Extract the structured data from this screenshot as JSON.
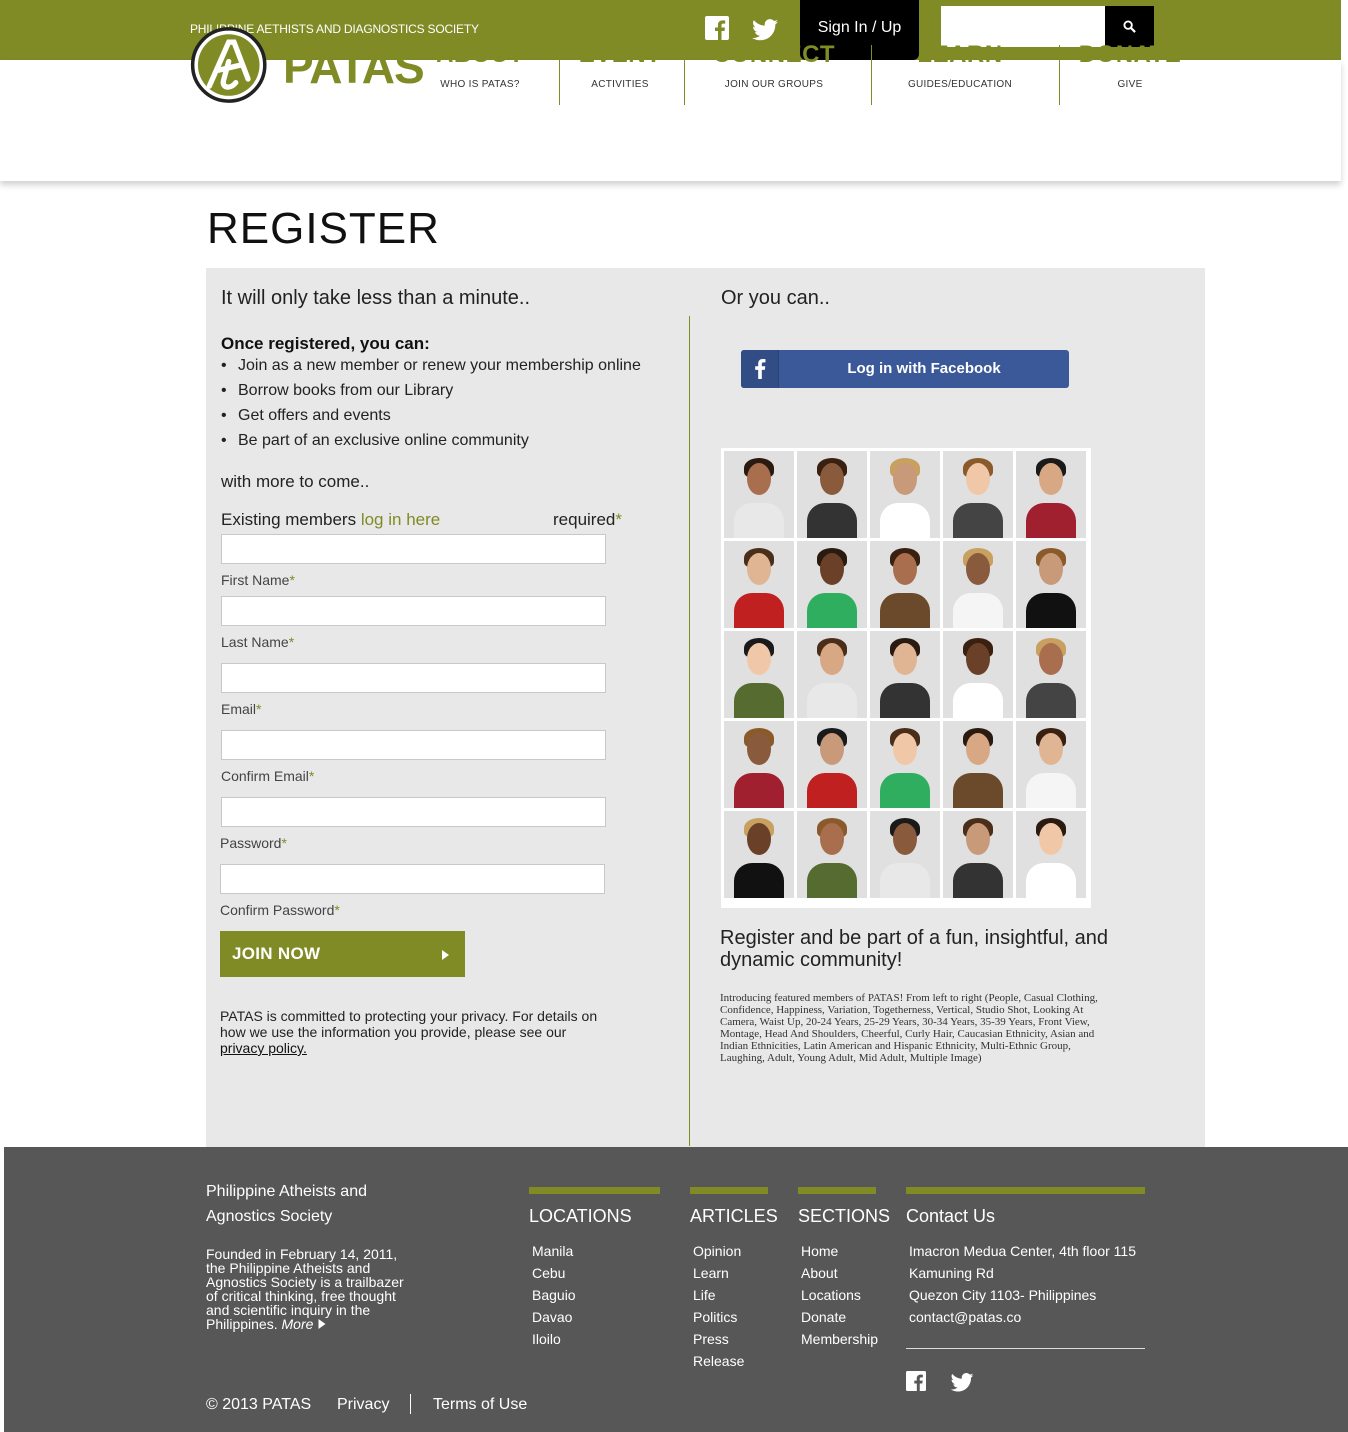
{
  "topbar": {
    "org_name": "PHILIPPINE AETHISTS AND DIAGNOSTICS SOCIETY",
    "signin": "Sign In / Up",
    "search_placeholder": "",
    "icons": [
      "facebook-icon",
      "twitter-icon",
      "search-icon"
    ]
  },
  "brand": {
    "logo_text": "PATAS",
    "accent": "#818b26"
  },
  "nav": [
    {
      "title": "ABOUT",
      "sub": "WHO IS PATAS?"
    },
    {
      "title": "EVENT",
      "sub": "ACTIVITIES"
    },
    {
      "title": "CONNECT",
      "sub": "JOIN OUR GROUPS"
    },
    {
      "title": "LEARN",
      "sub": "GUIDES/EDUCATION"
    },
    {
      "title": "DONATE",
      "sub": "GIVE"
    }
  ],
  "page": {
    "title": "REGISTER",
    "left_lead": "It will only take less than a minute..",
    "once_heading": "Once registered, you can:",
    "benefits": [
      "Join as a new member or renew your membership online",
      "Borrow books from our Library",
      "Get offers and events",
      "Be part of an exclusive online community"
    ],
    "more_to_come": "with more to come..",
    "existing_prefix": "Existing members ",
    "existing_link": "log in here",
    "required": "required",
    "fields": [
      {
        "label": "First Name"
      },
      {
        "label": "Last Name"
      },
      {
        "label": "Email"
      },
      {
        "label": "Confirm Email"
      },
      {
        "label": "Password"
      },
      {
        "label": "Confirm Password"
      }
    ],
    "join_button": "JOIN NOW",
    "privacy_text": "PATAS is committed to protecting your privacy. For details on how we use the information you provide, please see our",
    "privacy_link": "privacy policy.",
    "right_lead": "Or you can..",
    "facebook_button": "Log in with Facebook",
    "tagline": "Register and be part of a fun, insightful, and dynamic community!",
    "caption": "Introducing featured members of PATAS! From left to right (People, Casual Clothing, Confidence, Happiness, Variation, Togetherness, Vertical, Studio Shot, Looking At Camera, Waist Up, 20-24 Years, 25-29 Years, 30-34 Years, 35-39 Years, Front View, Montage, Head And Shoulders, Cheerful, Curly Hair, Caucasian Ethnicity, Asian and Indian Ethnicities, Latin American and Hispanic Ethnicity, Multi-Ethnic Group, Laughing, Adult, Young Adult, Mid Adult, Multiple Image)"
  },
  "footer": {
    "org_name": "Philippine Atheists and Agnostics Society",
    "description": "Founded in February 14, 2011, the Philippine Atheists and Agnostics Society is a trailbazer of critical thinking, free thought and scientific inquiry in the Philippines.",
    "more": "More",
    "columns": [
      {
        "heading": "LOCATIONS",
        "items": [
          "Manila",
          "Cebu",
          "Baguio",
          "Davao",
          "Iloilo"
        ]
      },
      {
        "heading": "ARTICLES",
        "items": [
          "Opinion",
          "Learn",
          "Life",
          "Politics",
          "Press",
          "Release"
        ]
      },
      {
        "heading": "SECTIONS",
        "items": [
          "Home",
          "About",
          "Locations",
          "Donate",
          "Membership"
        ]
      },
      {
        "heading": "Contact Us",
        "items": [
          "Imacron Medua Center, 4th floor 115",
          "Kamuning Rd",
          "Quezon City 1103- Philippines",
          "contact@patas.co"
        ]
      }
    ],
    "copyright": "© 2013 PATAS",
    "privacy": "Privacy",
    "terms": "Terms of Use"
  }
}
